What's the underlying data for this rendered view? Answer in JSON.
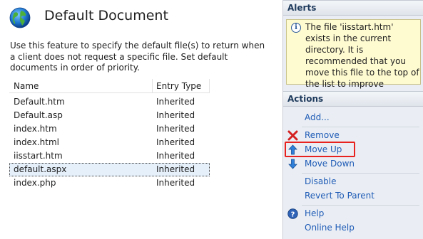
{
  "page": {
    "title": "Default Document",
    "description": "Use this feature to specify the default file(s) to return when a client does not request a specific file. Set default documents in order of priority."
  },
  "grid": {
    "columns": [
      "Name",
      "Entry Type"
    ],
    "rows": [
      {
        "name": "Default.htm",
        "type": "Inherited"
      },
      {
        "name": "Default.asp",
        "type": "Inherited"
      },
      {
        "name": "index.htm",
        "type": "Inherited"
      },
      {
        "name": "index.html",
        "type": "Inherited"
      },
      {
        "name": "iisstart.htm",
        "type": "Inherited"
      },
      {
        "name": "default.aspx",
        "type": "Inherited"
      },
      {
        "name": "index.php",
        "type": "Inherited"
      }
    ],
    "selected_index": 5
  },
  "alerts": {
    "header": "Alerts",
    "icon": "info-icon",
    "message": "The file 'iisstart.htm' exists in the current directory. It is recommended that you move this file to the top of the list to improve performance."
  },
  "actions": {
    "header": "Actions",
    "items": [
      {
        "id": "add",
        "label": "Add...",
        "icon": "none"
      },
      {
        "id": "remove",
        "label": "Remove",
        "icon": "red-x-icon"
      },
      {
        "id": "move-up",
        "label": "Move Up",
        "icon": "blue-up-arrow-icon"
      },
      {
        "id": "move-down",
        "label": "Move Down",
        "icon": "blue-down-arrow-icon"
      },
      {
        "id": "disable",
        "label": "Disable",
        "icon": "none"
      },
      {
        "id": "revert",
        "label": "Revert To Parent",
        "icon": "none"
      },
      {
        "id": "help",
        "label": "Help",
        "icon": "help-icon"
      },
      {
        "id": "online-help",
        "label": "Online Help",
        "icon": "none"
      }
    ]
  },
  "colors": {
    "link": "#1f5bb6",
    "annotation": "#e8231f",
    "alert_bg": "#fffbd1",
    "panel_bg": "#eaeef4"
  }
}
